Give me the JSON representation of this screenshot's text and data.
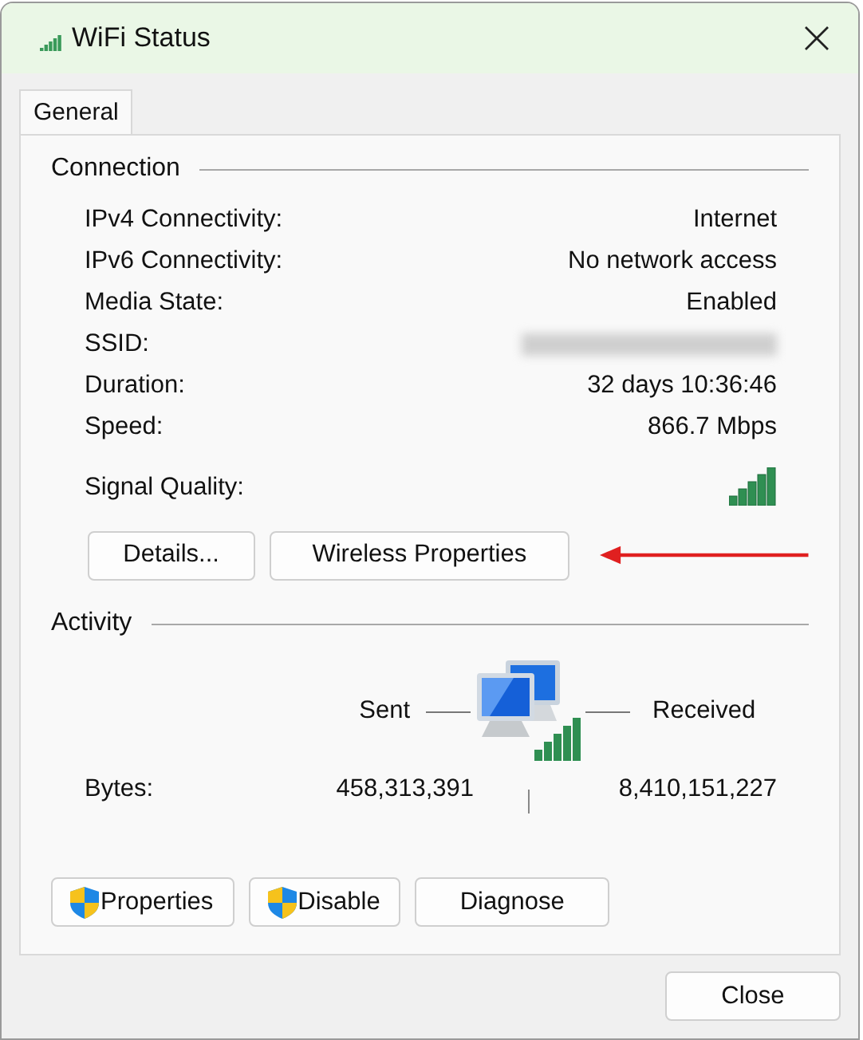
{
  "window": {
    "title": "WiFi Status"
  },
  "tabs": [
    {
      "label": "General",
      "selected": true
    }
  ],
  "connection": {
    "heading": "Connection",
    "rows": [
      {
        "label": "IPv4 Connectivity:",
        "value": "Internet"
      },
      {
        "label": "IPv6 Connectivity:",
        "value": "No network access"
      },
      {
        "label": "Media State:",
        "value": "Enabled"
      },
      {
        "label": "SSID:",
        "kind": "redacted"
      },
      {
        "label": "Duration:",
        "value": "32 days 10:36:46"
      },
      {
        "label": "Speed:",
        "value": "866.7 Mbps"
      },
      {
        "label": "Signal Quality:",
        "kind": "signal"
      }
    ],
    "buttons": [
      "Details...",
      "Wireless Properties"
    ]
  },
  "activity": {
    "heading": "Activity",
    "sent_label": "Sent",
    "received_label": "Received",
    "bytes_label": "Bytes:",
    "bytes_sent": "458,313,391",
    "bytes_received": "8,410,151,227"
  },
  "action_buttons": [
    {
      "label": "Properties",
      "shield": true
    },
    {
      "label": "Disable",
      "shield": true
    },
    {
      "label": "Diagnose",
      "shield": false
    }
  ],
  "close_button": "Close"
}
